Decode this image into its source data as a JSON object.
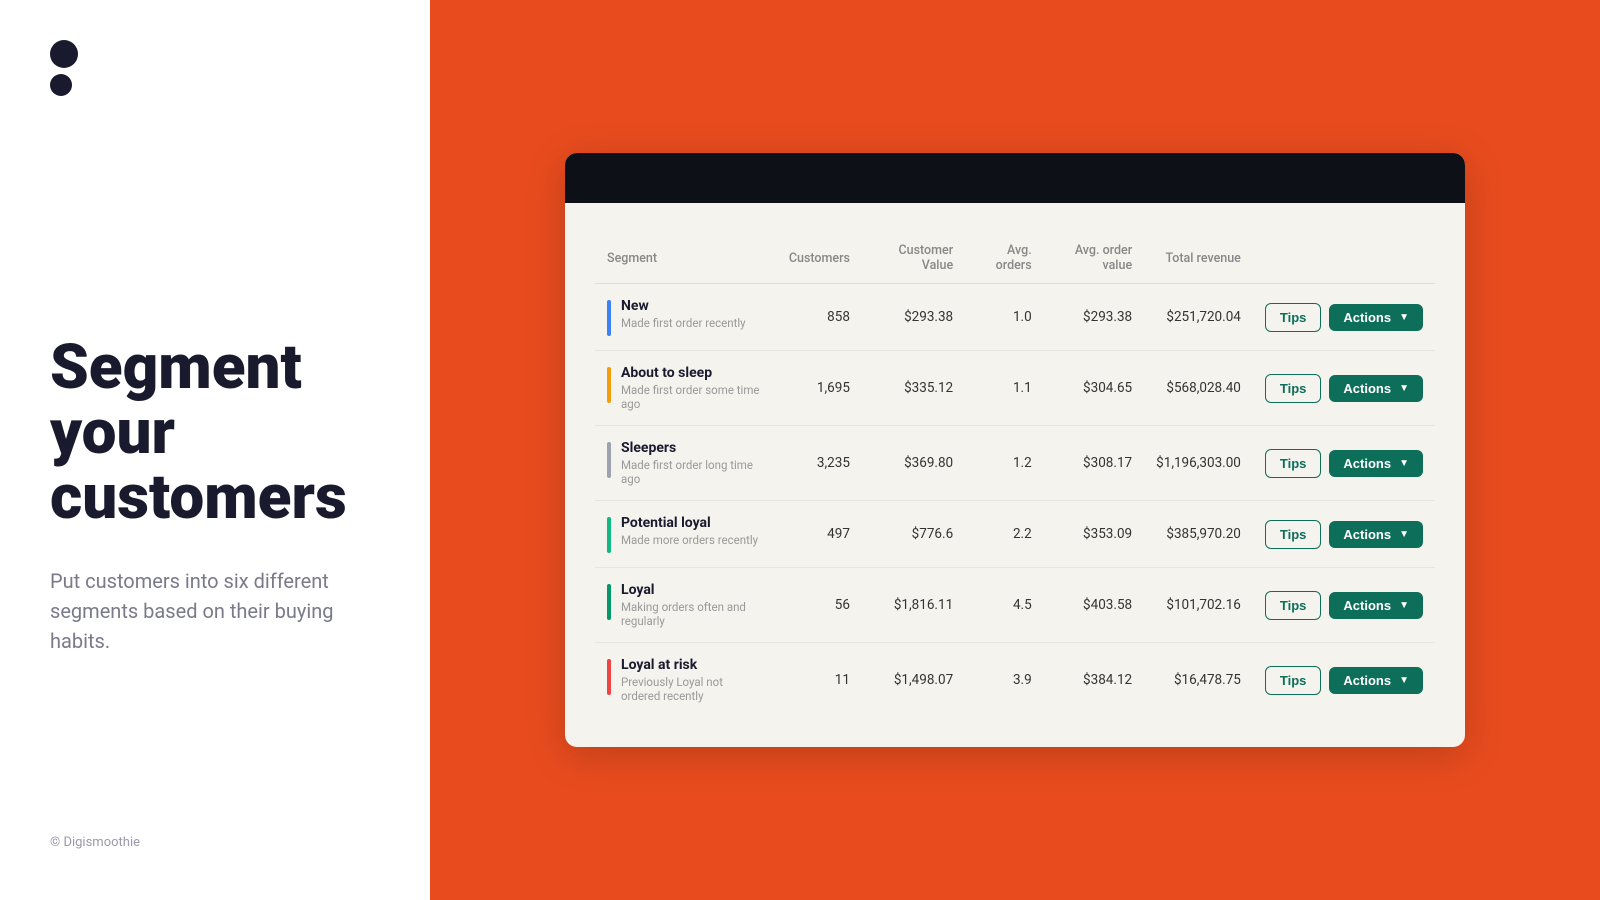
{
  "left": {
    "logo_dots": [
      "large",
      "small"
    ],
    "heading": "Segment your customers",
    "subtext": "Put customers into six different segments based on their buying habits.",
    "footer": "© Digismoothie"
  },
  "table": {
    "columns": [
      "Segment",
      "Customers",
      "Customer Value",
      "Avg. orders",
      "Avg. order value",
      "Total revenue"
    ],
    "rows": [
      {
        "id": "new",
        "color": "#3b82f6",
        "name": "New",
        "desc": "Made first order recently",
        "customers": "858",
        "customer_value": "$293.38",
        "avg_orders": "1.0",
        "avg_order_value": "$293.38",
        "total_revenue": "$251,720.04"
      },
      {
        "id": "about-to-sleep",
        "color": "#f59e0b",
        "name": "About to sleep",
        "desc": "Made first order some time ago",
        "customers": "1,695",
        "customer_value": "$335.12",
        "avg_orders": "1.1",
        "avg_order_value": "$304.65",
        "total_revenue": "$568,028.40"
      },
      {
        "id": "sleepers",
        "color": "#9ca3af",
        "name": "Sleepers",
        "desc": "Made first order long time ago",
        "customers": "3,235",
        "customer_value": "$369.80",
        "avg_orders": "1.2",
        "avg_order_value": "$308.17",
        "total_revenue": "$1,196,303.00"
      },
      {
        "id": "potential-loyal",
        "color": "#10b981",
        "name": "Potential loyal",
        "desc": "Made more orders recently",
        "customers": "497",
        "customer_value": "$776.6",
        "avg_orders": "2.2",
        "avg_order_value": "$353.09",
        "total_revenue": "$385,970.20"
      },
      {
        "id": "loyal",
        "color": "#059669",
        "name": "Loyal",
        "desc": "Making orders often and regularly",
        "customers": "56",
        "customer_value": "$1,816.11",
        "avg_orders": "4.5",
        "avg_order_value": "$403.58",
        "total_revenue": "$101,702.16"
      },
      {
        "id": "loyal-at-risk",
        "color": "#ef4444",
        "name": "Loyal at risk",
        "desc": "Previously Loyal not ordered recently",
        "customers": "11",
        "customer_value": "$1,498.07",
        "avg_orders": "3.9",
        "avg_order_value": "$384.12",
        "total_revenue": "$16,478.75"
      }
    ],
    "btn_tips": "Tips",
    "btn_actions": "Actions"
  }
}
